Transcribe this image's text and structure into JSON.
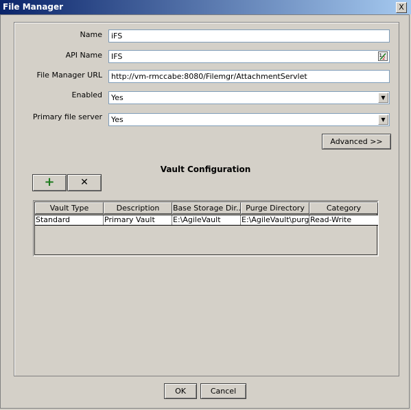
{
  "window": {
    "title": "File Manager",
    "close_symbol": "X"
  },
  "form": {
    "name_label": "Name",
    "name_value": "iFS",
    "api_name_label": "API Name",
    "api_name_value": "IFS",
    "url_label": "File Manager URL",
    "url_value": "http://vm-rmccabe:8080/Filemgr/AttachmentServlet",
    "enabled_label": "Enabled",
    "enabled_value": "Yes",
    "primary_label": "Primary file server",
    "primary_value": "Yes"
  },
  "advanced_label": "Advanced >>",
  "vault": {
    "title": "Vault Configuration",
    "add_symbol": "+",
    "remove_symbol": "✕",
    "columns": [
      "Vault Type",
      "Description",
      "Base Storage Dir...",
      "Purge Directory",
      "Category"
    ],
    "rows": [
      [
        "Standard",
        "Primary Vault",
        "E:\\AgileVault",
        "E:\\AgileVault\\purge",
        "Read-Write"
      ]
    ]
  },
  "footer": {
    "ok_label": "OK",
    "cancel_label": "Cancel"
  }
}
